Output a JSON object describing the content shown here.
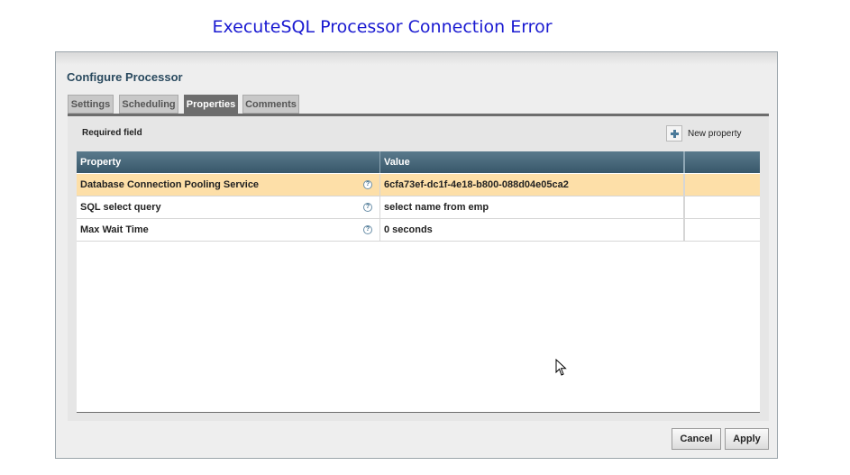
{
  "page": {
    "title": "ExecuteSQL Processor Connection Error"
  },
  "dialog": {
    "title": "Configure Processor",
    "tabs": [
      {
        "label": "Settings",
        "active": false
      },
      {
        "label": "Scheduling",
        "active": false
      },
      {
        "label": "Properties",
        "active": true
      },
      {
        "label": "Comments",
        "active": false
      }
    ],
    "required_field_label": "Required field",
    "new_property_label": "New property",
    "table": {
      "columns": [
        "Property",
        "Value",
        ""
      ],
      "rows": [
        {
          "property": "Database Connection Pooling Service",
          "value": "6cfa73ef-dc1f-4e18-b800-088d04e05ca2",
          "selected": true
        },
        {
          "property": "SQL select query",
          "value": "select name from emp",
          "selected": false
        },
        {
          "property": "Max Wait Time",
          "value": "0 seconds",
          "selected": false
        }
      ]
    },
    "buttons": {
      "cancel": "Cancel",
      "apply": "Apply"
    }
  },
  "icons": {
    "help": "question-circle-icon",
    "add": "plus-icon",
    "cursor": "mouse-pointer-icon"
  },
  "colors": {
    "title": "#1a1ad1",
    "header": "#38576a",
    "selected_row": "#fddfa8",
    "active_tab": "#6d6d6d"
  }
}
